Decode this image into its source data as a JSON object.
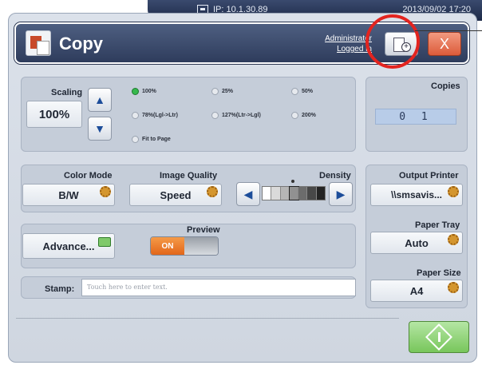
{
  "status": {
    "ip": "IP: 10.1.30.89",
    "clock": "2013/09/02 17:20"
  },
  "header": {
    "title": "Copy",
    "user_line1": "Administrator",
    "user_line2": "Logged in",
    "close_label": "X"
  },
  "scaling": {
    "label": "Scaling",
    "value": "100%",
    "options": {
      "opt1": "100%",
      "opt2": "25%",
      "opt3": "50%",
      "opt4": "78%(Lgl->Ltr)",
      "opt5": "127%(Ltr->Lgl)",
      "opt6": "200%",
      "opt7": "Fit to Page"
    },
    "selected": "100%"
  },
  "copies": {
    "label": "Copies",
    "value": "0 1"
  },
  "color_mode": {
    "label": "Color Mode",
    "value": "B/W"
  },
  "image_quality": {
    "label": "Image Quality",
    "value": "Speed"
  },
  "density": {
    "label": "Density",
    "level": 4,
    "levels": 7
  },
  "output_printer": {
    "label": "Output Printer",
    "value": "\\\\smsavis..."
  },
  "advanced": {
    "label": "Advance..."
  },
  "preview": {
    "label": "Preview",
    "state": "ON"
  },
  "paper_tray": {
    "label": "Paper Tray",
    "value": "Auto"
  },
  "paper_size": {
    "label": "Paper Size",
    "value": "A4"
  },
  "stamp": {
    "label": "Stamp:",
    "placeholder": "Touch here to enter text."
  },
  "colors": {
    "accent_red": "#e3241f",
    "header_blue": "#3d4d70",
    "start_green": "#78c65b",
    "preview_orange": "#e2661a"
  }
}
